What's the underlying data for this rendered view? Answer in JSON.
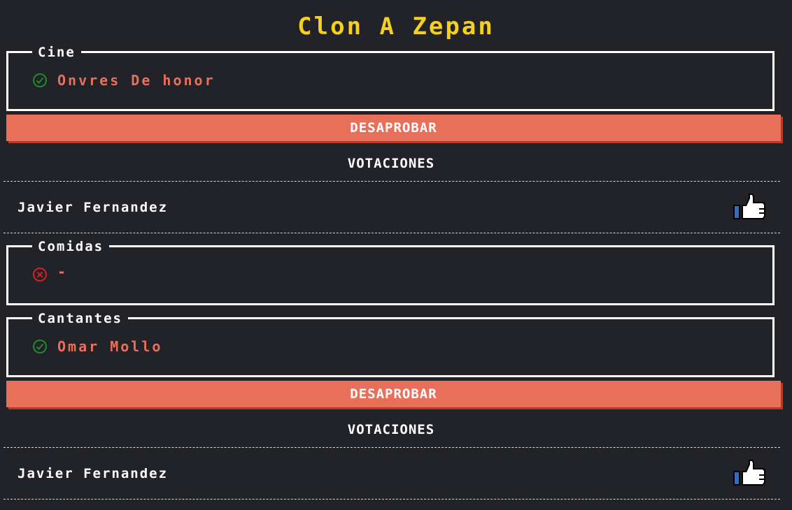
{
  "app": {
    "title": "Clon A Zepan"
  },
  "categories": [
    {
      "name": "Cine",
      "entry": "Onvres De honor",
      "status": "approved",
      "status_icon": "check-circle-icon",
      "action_label": "DESAPROBAR",
      "votes_heading": "VOTACIONES",
      "voters": [
        {
          "name": "Javier Fernandez",
          "icon": "thumbs-up-icon"
        }
      ]
    },
    {
      "name": "Comidas",
      "entry": "-",
      "status": "rejected",
      "status_icon": "x-circle-icon"
    },
    {
      "name": "Cantantes",
      "entry": "Omar Mollo",
      "status": "approved",
      "status_icon": "check-circle-icon",
      "action_label": "DESAPROBAR",
      "votes_heading": "VOTACIONES",
      "voters": [
        {
          "name": "Javier Fernandez",
          "icon": "thumbs-up-icon"
        }
      ]
    }
  ],
  "colors": {
    "background": "#212328",
    "title": "#f5d020",
    "accent": "#e8705a",
    "accent_shadow": "#b83a26",
    "approved": "#1f8a2e",
    "rejected": "#d62020",
    "thumb_blue": "#2f6fbf"
  }
}
